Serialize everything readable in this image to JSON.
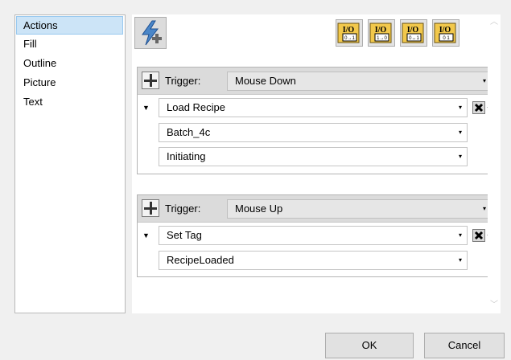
{
  "nav": {
    "items": [
      {
        "label": "Actions",
        "selected": true
      },
      {
        "label": "Fill",
        "selected": false
      },
      {
        "label": "Outline",
        "selected": false
      },
      {
        "label": "Picture",
        "selected": false
      },
      {
        "label": "Text",
        "selected": false
      }
    ]
  },
  "toolbar": {
    "add_action_icon": "lightning-plus-icon",
    "io_buttons": [
      {
        "name": "io-0-1-icon",
        "io": "I/O",
        "sub": "0→1"
      },
      {
        "name": "io-1-0-icon",
        "io": "I/O",
        "sub": "1→0"
      },
      {
        "name": "io-0-1-0-icon",
        "io": "I/O",
        "sub": "0↔1"
      },
      {
        "name": "io-0-1-toggle-icon",
        "io": "I/O",
        "sub": "0 1"
      }
    ]
  },
  "triggers": [
    {
      "label": "Trigger:",
      "event": "Mouse Down",
      "action": "Load Recipe",
      "params": [
        "Batch_4c",
        "Initiating"
      ]
    },
    {
      "label": "Trigger:",
      "event": "Mouse Up",
      "action": "Set Tag",
      "params": [
        "RecipeLoaded"
      ]
    }
  ],
  "footer": {
    "ok": "OK",
    "cancel": "Cancel"
  }
}
